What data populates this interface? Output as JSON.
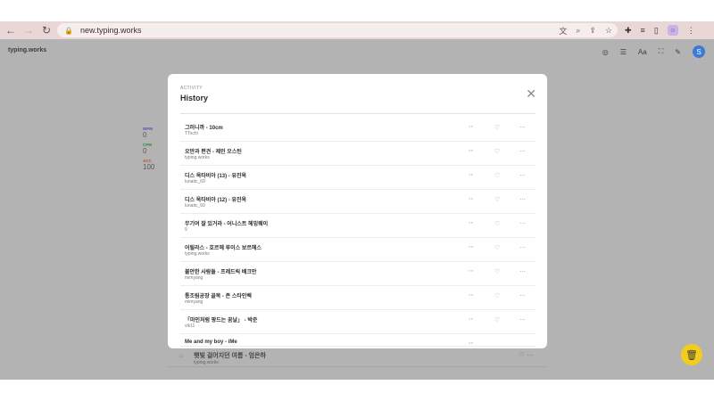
{
  "browser": {
    "url": "new.typing.works",
    "icons": [
      "back-icon",
      "forward-icon",
      "reload-icon",
      "lock-icon",
      "translate-icon",
      "zoom-icon",
      "share-icon",
      "star-icon",
      "extensions-icon",
      "media-icon",
      "sidepanel-icon",
      "profile-icon",
      "menu-icon"
    ]
  },
  "app": {
    "brand": "typing.works",
    "toolbar": {
      "font_label": "Aa",
      "user_initial": "S"
    },
    "stats": [
      {
        "label": "WPM",
        "value": "0"
      },
      {
        "label": "CPM",
        "value": "0"
      },
      {
        "label": "ACC",
        "value": "100"
      }
    ],
    "background_row": {
      "title": "햇빛 걸어지던 여름 - 엄은하",
      "author": "typing.works"
    }
  },
  "modal": {
    "eyebrow": "ACTIVITY",
    "title": "History",
    "items": [
      {
        "title": "그러니까 - 10cm",
        "author": "TTochi"
      },
      {
        "title": "오만과 편견 - 제인 오스틴",
        "author": "typing.works"
      },
      {
        "title": "디스 옥타비아 (13) - 유진옥",
        "author": "lunatic_69"
      },
      {
        "title": "디스 옥타비아 (12) - 유진옥",
        "author": "lunatic_69"
      },
      {
        "title": "무기여 잘 있거라 - 어니스트 헤밍웨이",
        "author": "9"
      },
      {
        "title": "어릴라스 - 호르헤 루이스 보르헤스",
        "author": "typing.works"
      },
      {
        "title": "불안한 사람들 - 프레드릭 배크만",
        "author": "mimyang"
      },
      {
        "title": "통조림공장 골목 - 존 스타인벡",
        "author": "mimyang"
      },
      {
        "title": "「마인처럼 팡드는 꿈날」 - 박준",
        "author": "vlk11"
      },
      {
        "title": "Me and my boy - iMe",
        "author": ""
      }
    ]
  }
}
